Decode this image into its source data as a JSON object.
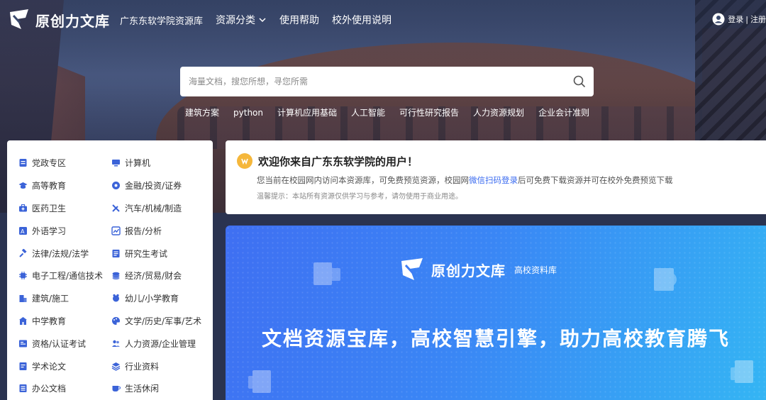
{
  "header": {
    "logo_text": "原创力文库",
    "school_name": "广东东软学院资源库",
    "nav": [
      {
        "label": "资源分类"
      },
      {
        "label": "使用帮助"
      },
      {
        "label": "校外使用说明"
      }
    ],
    "login_label": "登录",
    "separator": "|",
    "register_label": "注册"
  },
  "search": {
    "placeholder": "海量文档，搜您所想，寻您所需",
    "hot_tags": [
      "建筑方案",
      "python",
      "计算机应用基础",
      "人工智能",
      "可行性研究报告",
      "人力资源规划",
      "企业会计准则"
    ]
  },
  "categories": [
    {
      "label": "党政专区",
      "icon": "party-icon"
    },
    {
      "label": "计算机",
      "icon": "computer-icon"
    },
    {
      "label": "高等教育",
      "icon": "graduation-cap-icon"
    },
    {
      "label": "金融/投资/证券",
      "icon": "finance-icon"
    },
    {
      "label": "医药卫生",
      "icon": "medical-kit-icon"
    },
    {
      "label": "汽车/机械/制造",
      "icon": "tools-icon"
    },
    {
      "label": "外语学习",
      "icon": "language-icon"
    },
    {
      "label": "报告/分析",
      "icon": "chart-icon"
    },
    {
      "label": "法律/法规/法学",
      "icon": "gavel-icon"
    },
    {
      "label": "研究生考试",
      "icon": "exam-icon"
    },
    {
      "label": "电子工程/通信技术",
      "icon": "chip-icon"
    },
    {
      "label": "经济/贸易/财会",
      "icon": "coins-icon"
    },
    {
      "label": "建筑/施工",
      "icon": "building-icon"
    },
    {
      "label": "幼儿/小学教育",
      "icon": "toy-icon"
    },
    {
      "label": "中学教育",
      "icon": "school-icon"
    },
    {
      "label": "文学/历史/军事/艺术",
      "icon": "palette-icon"
    },
    {
      "label": "资格/认证考试",
      "icon": "certificate-icon"
    },
    {
      "label": "人力资源/企业管理",
      "icon": "people-icon"
    },
    {
      "label": "学术论文",
      "icon": "paper-icon"
    },
    {
      "label": "行业资料",
      "icon": "layers-icon"
    },
    {
      "label": "办公文档",
      "icon": "document-icon"
    },
    {
      "label": "生活休闲",
      "icon": "cup-icon"
    }
  ],
  "welcome": {
    "title": "欢迎你来自广东东软学院的用户！",
    "line_pre": "您当前在校园网内访问本资源库，可免费预览资源，校园网",
    "line_link": "微信扫码登录",
    "line_post": "后可免费下载资源并可在校外免费预览下载",
    "tip": "温馨提示：本站所有资源仅供学习与参考，请勿使用于商业用途。"
  },
  "banner": {
    "logo_text": "原创力文库",
    "sub_text": "高校资料库",
    "slogan": "文档资源宝库，高校智慧引擎，助力高校教育腾飞"
  },
  "colors": {
    "accent": "#3c6cf0",
    "icon_blue": "#3b63d8",
    "badge": "#f5b73b",
    "banner_start": "#3f6ff2",
    "banner_end": "#34b5f4"
  }
}
